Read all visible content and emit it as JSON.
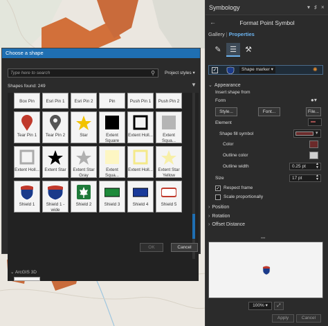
{
  "dialog": {
    "title": "Choose a shape",
    "search_placeholder": "Type here to search",
    "styles_label": "Project styles",
    "found_label": "Shapes found: 249",
    "group_label": "ArcGIS 3D",
    "ok_label": "OK",
    "cancel_label": "Cancel",
    "rows": [
      [
        "Box Pin",
        "Esri Pin 1",
        "Esri Pin 2",
        "Pin",
        "Push Pin 1",
        "Push Pin 2"
      ],
      [
        "Tear Pin 1",
        "Tear Pin 2",
        "Star",
        "Extent Square",
        "Extent Holl...",
        "Extent Squa..."
      ],
      [
        "Extent Holl...",
        "Extent Star",
        "Extent Star Gray",
        "Extent Squa...",
        "Extent Holl...",
        "Extent Star Yellow"
      ],
      [
        "Shield 1",
        "Shield 1 - wide",
        "Shield 2",
        "Shield 3",
        "Shield 4",
        "Shield 5"
      ]
    ]
  },
  "pane": {
    "header": "Symbology",
    "title": "Format Point Symbol",
    "tab_gallery": "Gallery",
    "tab_properties": "Properties",
    "layer_label": "Shape marker",
    "appearance": "Appearance",
    "insert_shape": "Insert shape from",
    "form": "Form",
    "style_btn": "Style...",
    "font_btn": "Font...",
    "file_btn": "File...",
    "element": "Element",
    "shape_fill": "Shape fill symbol",
    "color": "Color",
    "outline_color": "Outline color",
    "outline_width": "Outline width",
    "outline_width_value": "0.25 pt",
    "size": "Size",
    "size_value": "17 pt",
    "respect_frame": "Respect frame",
    "scale_prop": "Scale proportionally",
    "position": "Position",
    "rotation": "Rotation",
    "offset": "Offset Distance",
    "zoom": "100%",
    "apply": "Apply",
    "cancel": "Cancel",
    "fill_color": "#6b2a2a"
  }
}
